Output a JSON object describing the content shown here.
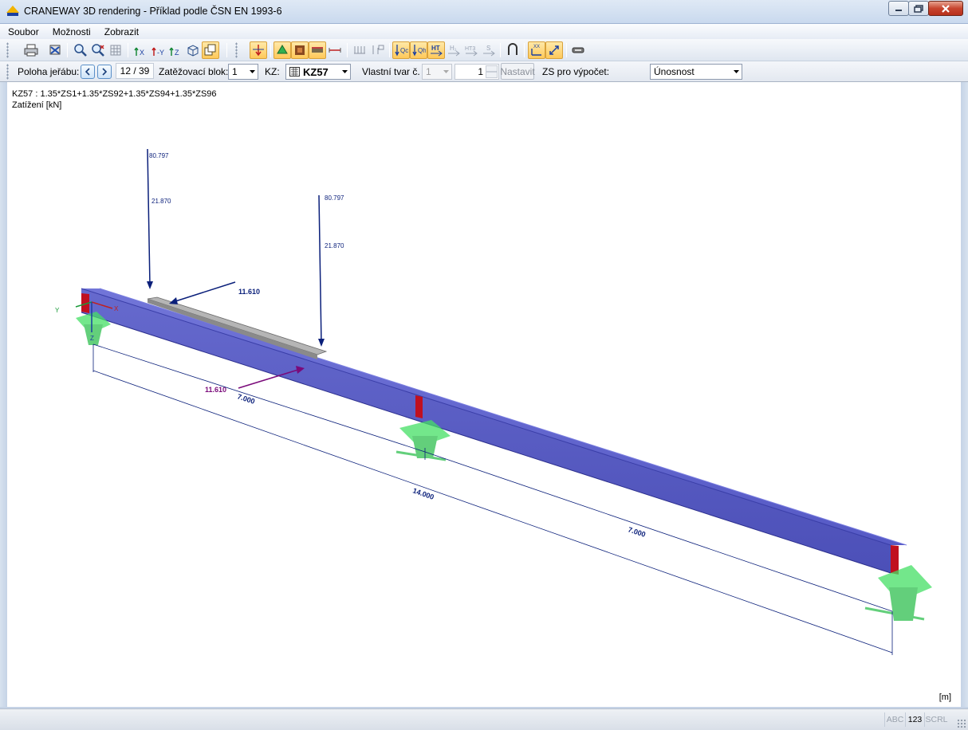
{
  "window": {
    "title": "CRANEWAY 3D rendering - Příklad podle ČSN EN 1993-6"
  },
  "menu": {
    "items": [
      "Soubor",
      "Možnosti",
      "Zobrazit"
    ]
  },
  "toolbar": {
    "buttons": [
      "print-icon",
      "print-setup-icon",
      "zoom-icon",
      "zoom-reset-icon",
      "grid-icon",
      "view-x-icon",
      "view-y-icon",
      "view-z-icon",
      "view-iso-icon",
      "view-3d-icon",
      "load-arrows-icon",
      "supports-icon",
      "section-icon",
      "model-icon",
      "dimension-icon",
      "load-values-icon",
      "load-labels-icon",
      "qc-icon",
      "qh-icon",
      "ht-icon",
      "h1-icon",
      "ht3-icon",
      "s-icon",
      "magnet-icon",
      "axis-icon",
      "resize-icon",
      "tape-icon"
    ]
  },
  "options": {
    "crane_position_label": "Poloha jeřábu:",
    "crane_position_value": "12 / 39",
    "load_block_label": "Zatěžovací blok:",
    "load_block_value": "1",
    "kz_label": "KZ:",
    "kz_value": "KZ57",
    "eigenshape_label": "Vlastní tvar č.",
    "eigenshape_value": "1",
    "eigenshape_spin_value": "1",
    "set_button": "Nastavit",
    "zs_label": "ZS pro výpočet:",
    "zs_value": "Únosnost"
  },
  "canvas": {
    "combination_line": "KZ57 : 1.35*ZS1+1.35*ZS92+1.35*ZS94+1.35*ZS96",
    "load_line": "Zatížení [kN]",
    "unit": "[m]",
    "axis_labels": {
      "x": "X",
      "y": "Y",
      "z": "Z"
    },
    "loads": {
      "v1_top": "80.797",
      "v1_mid": "21.870",
      "v2_top": "80.797",
      "v2_mid": "21.870",
      "horiz_top": "11.610",
      "horiz_bottom": "11.610"
    },
    "dimensions": {
      "left_span": "7.000",
      "total": "14.000",
      "right_span": "7.000"
    },
    "colors": {
      "beam": "#4a4ec0",
      "load_arrow": "#0a1f7a",
      "horizontal_load": "#7a0a7a",
      "support": "#40e060",
      "support_plate": "#c01020"
    }
  },
  "statusbar": {
    "cells": [
      "ABC",
      "123",
      "SCRL"
    ]
  }
}
